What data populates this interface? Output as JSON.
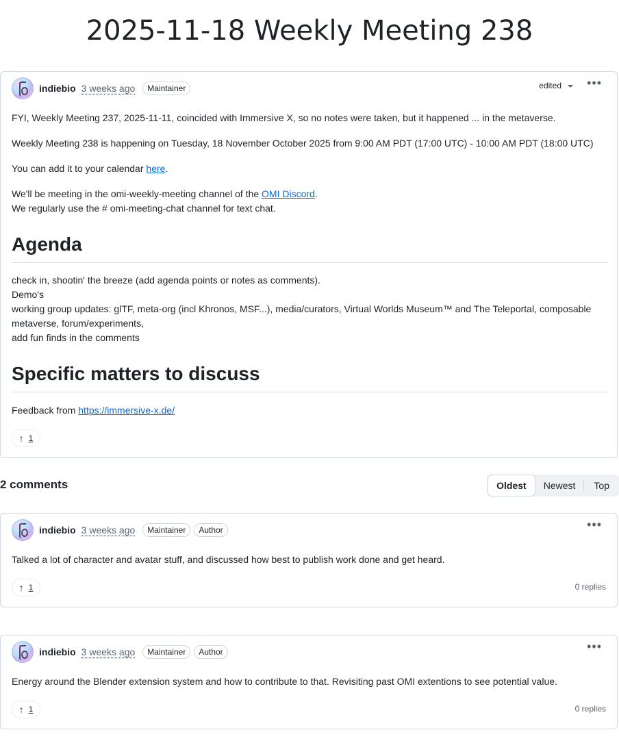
{
  "page": {
    "title": "2025-11-18 Weekly Meeting 238"
  },
  "post": {
    "author": "indiebio",
    "time": "3 weeks ago",
    "badge": "Maintainer",
    "edited": "edited",
    "para1": "FYI, Weekly Meeting 237, 2025-11-11, coincided with Immersive X, so no notes were taken, but it happened ... in the metaverse.",
    "para2": "Weekly Meeting 238 is happening on Tuesday, 18 November October 2025 from 9:00 AM PDT (17:00 UTC) - 10:00 AM PDT (18:00 UTC)",
    "para3_prefix": "You can add it to your calendar ",
    "para3_link": "here",
    "para3_suffix": ".",
    "para4_prefix": "We'll be meeting in the omi-weekly-meeting channel of the ",
    "para4_link": "OMI Discord",
    "para4_suffix": ".",
    "para4_line2": "We regularly use the # omi-meeting-chat channel for text chat.",
    "agenda_heading": "Agenda",
    "agenda_lines": [
      "check in, shootin' the breeze (add agenda points or notes as comments).",
      "Demo's",
      "working group updates: glTF, meta-org (incl Khronos, MSF...), media/curators, Virtual Worlds Museum™ and The Teleportal, composable",
      "metaverse, forum/experiments,",
      "add fun finds in the comments"
    ],
    "matters_heading": "Specific matters to discuss",
    "feedback_prefix": "Feedback from ",
    "feedback_link": "https://immersive-x.de/",
    "upvotes": "1"
  },
  "comments_header": {
    "count_label": "2 comments",
    "sort_options": [
      "Oldest",
      "Newest",
      "Top"
    ],
    "selected": "Oldest"
  },
  "comments": [
    {
      "author": "indiebio",
      "time": "3 weeks ago",
      "badges": [
        "Maintainer",
        "Author"
      ],
      "text": "Talked a lot of character and avatar stuff, and discussed how best to publish work done and get heard.",
      "upvotes": "1",
      "replies": "0 replies"
    },
    {
      "author": "indiebio",
      "time": "3 weeks ago",
      "badges": [
        "Maintainer",
        "Author"
      ],
      "text": "Energy around the Blender extension system and how to contribute to that. Revisiting past OMI extentions to see potential value.",
      "upvotes": "1",
      "replies": "0 replies"
    }
  ]
}
